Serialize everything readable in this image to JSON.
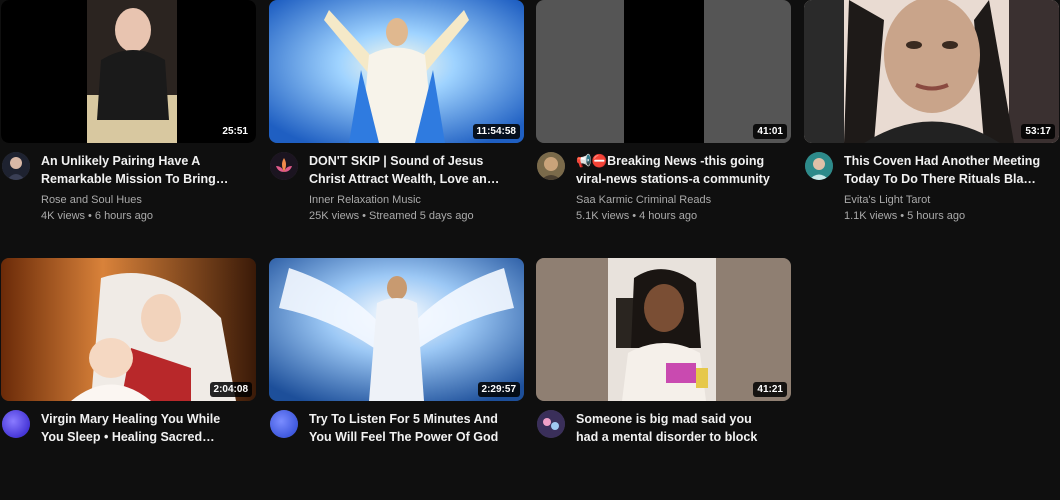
{
  "videos": [
    {
      "title": "An Unlikely Pairing Have A Remarkable Mission To Bring Love",
      "channel": "Rose and Soul Hues",
      "views": "4K views",
      "age": "6 hours ago",
      "duration": "25:51",
      "thumb_colors": [
        "#000000",
        "#3a3a3a",
        "#d8c8a0"
      ],
      "avatar_icon": "channel-avatar-icon"
    },
    {
      "title": "DON'T SKIP | Sound of Jesus Christ Attract Wealth, Love and Miracles",
      "channel": "Inner Relaxation Music",
      "views": "25K views",
      "age": "Streamed 5 days ago",
      "duration": "11:54:58",
      "thumb_colors": [
        "#2a6fd0",
        "#9fd3ff",
        "#f5e9c8"
      ],
      "avatar_icon": "lotus-avatar-icon"
    },
    {
      "title": "📢⛔Breaking News -this going viral-news stations-a community",
      "channel": "Saa Karmic Criminal Reads",
      "views": "5.1K views",
      "age": "4 hours ago",
      "duration": "41:01",
      "thumb_colors": [
        "#5a5a5a",
        "#000000",
        "#5a5a5a"
      ],
      "avatar_icon": "channel-avatar-icon"
    },
    {
      "title": "This Coven Had Another Meeting Today To Do There Rituals Black Magic",
      "channel": "Evita's Light Tarot",
      "views": "1.1K views",
      "age": "5 hours ago",
      "duration": "53:17",
      "thumb_colors": [
        "#c9a48a",
        "#e9dbd2",
        "#2a2a2a"
      ],
      "avatar_icon": "channel-avatar-icon"
    },
    {
      "title": "Virgin Mary Healing You While You Sleep • Healing Sacred Music",
      "channel": "",
      "views": "",
      "age": "",
      "duration": "2:04:08",
      "thumb_colors": [
        "#8a3d10",
        "#f0e8e0",
        "#d9a066"
      ],
      "avatar_icon": "channel-avatar-icon"
    },
    {
      "title": "Try To Listen For 5 Minutes And You Will Feel The Power Of God",
      "channel": "",
      "views": "",
      "age": "",
      "duration": "2:29:57",
      "thumb_colors": [
        "#1d4f9a",
        "#e8f2ff",
        "#7ab2ee"
      ],
      "avatar_icon": "channel-avatar-icon"
    },
    {
      "title": "Someone is big mad said you had a mental disorder to block",
      "channel": "",
      "views": "",
      "age": "",
      "duration": "41:21",
      "thumb_colors": [
        "#a08f80",
        "#2a2520",
        "#f5f0ea"
      ],
      "avatar_icon": "channel-avatar-icon"
    }
  ]
}
